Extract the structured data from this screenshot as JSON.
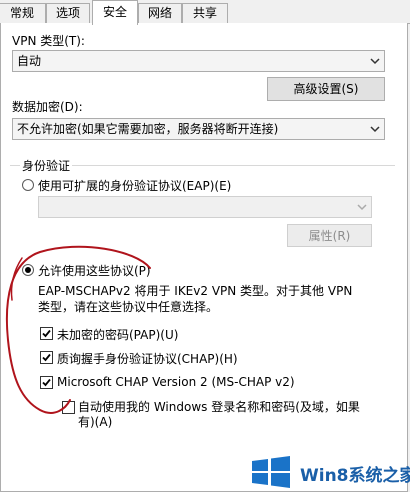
{
  "tabs": [
    {
      "label": "常规",
      "active": false
    },
    {
      "label": "选项",
      "active": false
    },
    {
      "label": "安全",
      "active": true
    },
    {
      "label": "网络",
      "active": false
    },
    {
      "label": "共享",
      "active": false
    }
  ],
  "vpn_type": {
    "label": "VPN 类型(T):",
    "value": "自动"
  },
  "advanced_button": "高级设置(S)",
  "encryption": {
    "label": "数据加密(D):",
    "value": "不允许加密(如果它需要加密，服务器将断开连接)"
  },
  "auth": {
    "group_label": "身份验证",
    "eap_radio": {
      "label": "使用可扩展的身份验证协议(EAP)(E)",
      "selected": false
    },
    "eap_select": {
      "value": "",
      "disabled": true
    },
    "properties_button": {
      "label": "属性(R)",
      "disabled": true
    },
    "protocols_radio": {
      "label": "允许使用这些协议(P)",
      "selected": true
    },
    "description_line1": "EAP-MSCHAPv2 将用于 IKEv2 VPN 类型。对于其他 VPN",
    "description_line2": "类型，请在这些协议中任意选择。",
    "checkboxes": [
      {
        "label": "未加密的密码(PAP)(U)",
        "checked": true
      },
      {
        "label": "质询握手身份验证协议(CHAP)(H)",
        "checked": true
      },
      {
        "label": "Microsoft CHAP Version 2 (MS-CHAP v2)",
        "checked": true
      }
    ],
    "auto_logon": {
      "line1": "自动使用我的 Windows 登录名称和密码(及域，如果",
      "line2": "有)(A)",
      "checked": false
    }
  },
  "watermark": {
    "text": "Win8系统之家",
    "logo_icon": "windows-logo-icon"
  },
  "colors": {
    "annotation": "#b0141c",
    "watermark_blue": "#1a5fa8"
  }
}
